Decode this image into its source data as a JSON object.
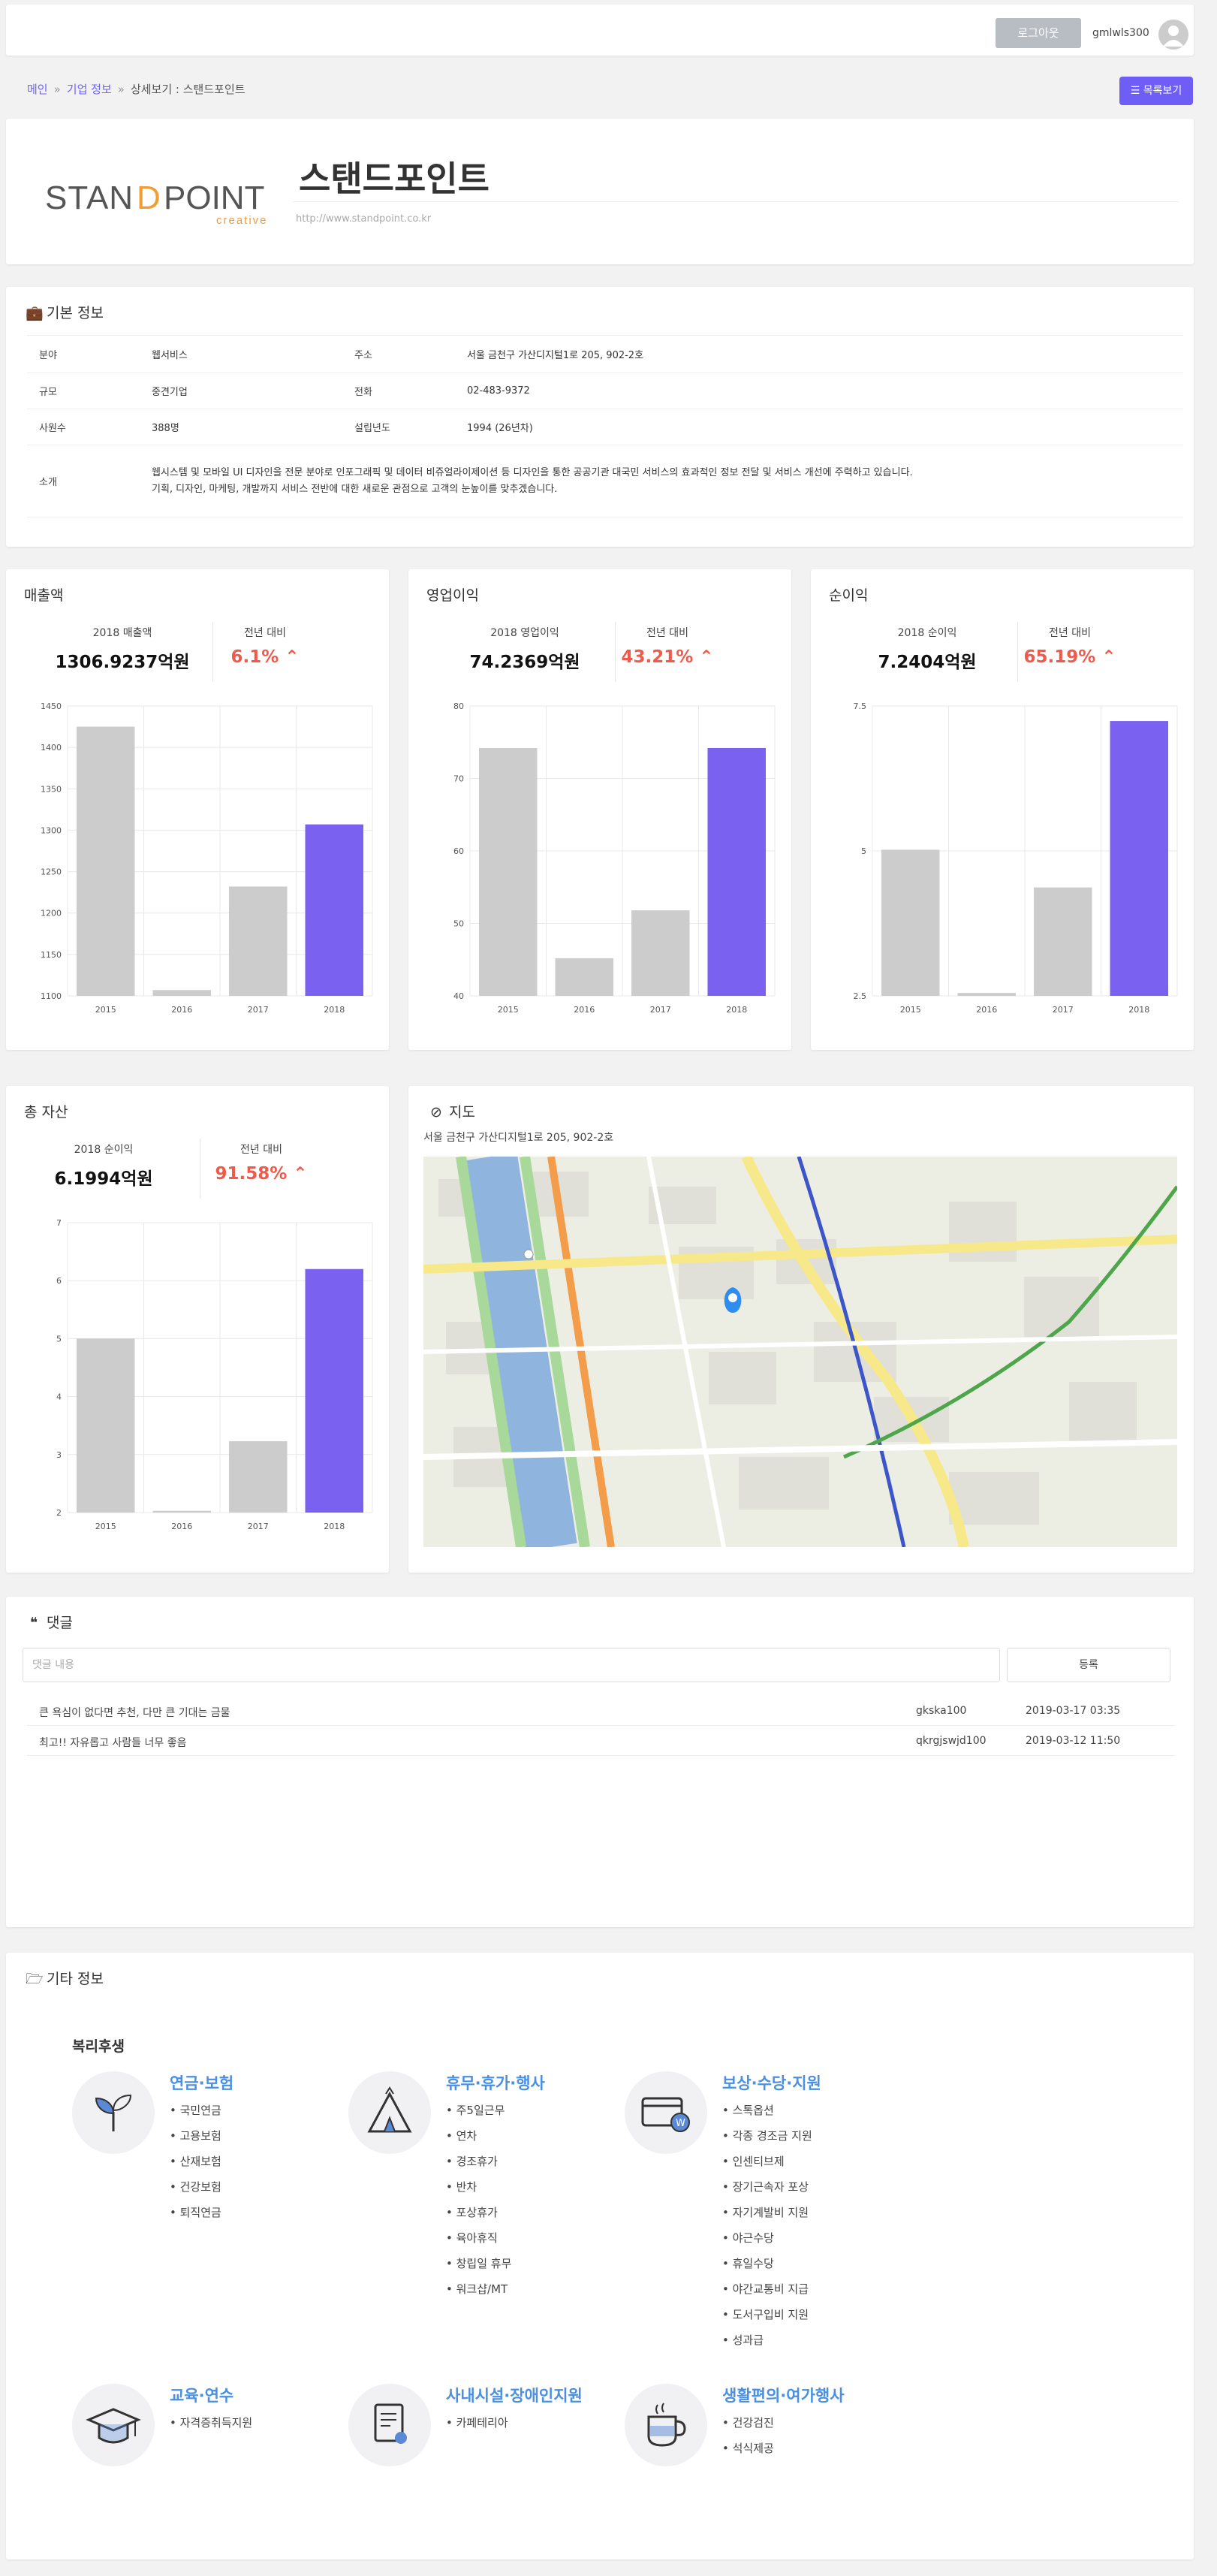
{
  "topbar": {
    "login_label": "로그아웃",
    "username": "gmlwls300"
  },
  "breadcrumb": {
    "home": "메인",
    "list": "기업 정보",
    "current": "상세보기 : 스탠드포인트",
    "sep": "»"
  },
  "list_button": "목록보기",
  "company": {
    "name": "스탠드포인트",
    "url": "http://www.standpoint.co.kr",
    "logo_text": "STANDPOINT",
    "logo_sub": "creative"
  },
  "basic": {
    "title": "기본 정보",
    "rows": {
      "field_label": "분야",
      "field": "웹서비스",
      "addr_label": "주소",
      "addr": "서울 금천구 가산디지털1로 205, 902-2호",
      "size_label": "규모",
      "size": "중견기업",
      "tel_label": "전화",
      "tel": "02-483-9372",
      "emp_label": "사원수",
      "emp": "388명",
      "est_label": "설립년도",
      "est": "1994 (26년차)",
      "intro_label": "소개",
      "intro1": "웹시스템 및 모바일 UI 디자인을 전문 분야로 인포그래픽 및 데이터 비쥬얼라이제이션 등 디자인을 통한 공공기관 대국민 서비스의 효과적인 정보 전달 및 서비스 개선에 주력하고 있습니다.",
      "intro2": "기획, 디자인, 마케팅, 개발까지 서비스 전반에 대한 새로운 관점으로 고객의 눈높이를 맞추겠습니다."
    }
  },
  "panels": [
    {
      "title": "매출액",
      "stat_label": "2018 매출액",
      "stat_value": "1306.9237",
      "unit": "억원",
      "rate_label": "전년 대비",
      "rate": "6.1%"
    },
    {
      "title": "영업이익",
      "stat_label": "2018 영업이익",
      "stat_value": "74.2369",
      "unit": "억원",
      "rate_label": "전년 대비",
      "rate": "43.21%"
    },
    {
      "title": "순이익",
      "stat_label": "2018 순이익",
      "stat_value": "7.2404",
      "unit": "억원",
      "rate_label": "전년 대비",
      "rate": "65.19%"
    },
    {
      "title": "총 자산",
      "stat_label": "2018 순이익",
      "stat_value": "6.1994",
      "unit": "억원",
      "rate_label": "전년 대비",
      "rate": "91.58%"
    }
  ],
  "chart_data": [
    {
      "type": "bar",
      "categories": [
        "2015",
        "2016",
        "2017",
        "2018"
      ],
      "values": [
        1425,
        1107,
        1232,
        1307
      ],
      "ylim": [
        1100,
        1450
      ],
      "yticks": [
        "1100",
        "1150",
        "1200",
        "1250",
        "1300",
        "1350",
        "1400",
        "1450"
      ],
      "grid": true,
      "colors": [
        "#cccccc",
        "#cccccc",
        "#cccccc",
        "#7b61f0"
      ]
    },
    {
      "type": "bar",
      "categories": [
        "2015",
        "2016",
        "2017",
        "2018"
      ],
      "values": [
        74.2,
        45.2,
        51.8,
        74.2
      ],
      "ylim": [
        40,
        80
      ],
      "yticks": [
        "40",
        "50",
        "60",
        "70",
        "80"
      ],
      "grid": true,
      "colors": [
        "#cccccc",
        "#cccccc",
        "#cccccc",
        "#7b61f0"
      ]
    },
    {
      "type": "bar",
      "categories": [
        "2015",
        "2016",
        "2017",
        "2018"
      ],
      "values": [
        5.02,
        2.55,
        4.37,
        7.24
      ],
      "ylim": [
        2.5,
        7.5
      ],
      "yticks": [
        "2.5",
        "5",
        "7.5"
      ],
      "grid": true,
      "colors": [
        "#cccccc",
        "#cccccc",
        "#cccccc",
        "#7b61f0"
      ]
    },
    {
      "type": "bar",
      "categories": [
        "2015",
        "2016",
        "2017",
        "2018"
      ],
      "values": [
        5.0,
        2.03,
        3.23,
        6.2
      ],
      "ylim": [
        2,
        7
      ],
      "yticks": [
        "2",
        "3",
        "4",
        "5",
        "6",
        "7"
      ],
      "grid": true,
      "colors": [
        "#cccccc",
        "#cccccc",
        "#cccccc",
        "#7b61f0"
      ]
    }
  ],
  "map": {
    "title": "지도",
    "address": "서울 금천구 가산디지털1로 205, 902-2호"
  },
  "comments": {
    "title": "댓글",
    "placeholder": "댓글 내용",
    "submit": "등록",
    "items": [
      {
        "text": "큰 욕심이 없다면 추천, 다만 큰 기대는 금물",
        "user": "gkska100",
        "date": "2019-03-17 03:35"
      },
      {
        "text": "최고!! 자유롭고 사람들 너무 좋음",
        "user": "qkrgjswjd100",
        "date": "2019-03-12 11:50"
      }
    ]
  },
  "etc": {
    "title": "기타 정보",
    "welfare_title": "복리후생",
    "groups": [
      {
        "name": "연금·보험",
        "icon": "plant-icon",
        "items": [
          "국민연금",
          "고용보험",
          "산재보험",
          "건강보험",
          "퇴직연금"
        ]
      },
      {
        "name": "휴무·휴가·행사",
        "icon": "tent-icon",
        "items": [
          "주5일근무",
          "연차",
          "경조휴가",
          "반차",
          "포상휴가",
          "육아휴직",
          "창립일 휴무",
          "워크샵/MT"
        ]
      },
      {
        "name": "보상·수당·지원",
        "icon": "card-icon",
        "items": [
          "스톡옵션",
          "각종 경조금 지원",
          "인센티브제",
          "장기근속자 포상",
          "자기계발비 지원",
          "야근수당",
          "휴일수당",
          "야간교통비 지급",
          "도서구입비 지원",
          "성과급"
        ]
      },
      {
        "name": "교육·연수",
        "icon": "graduation-cap-icon",
        "items": [
          "자격증취득지원"
        ]
      },
      {
        "name": "사내시설·장애인지원",
        "icon": "document-icon",
        "items": [
          "카페테리아"
        ]
      },
      {
        "name": "생활편의·여가행사",
        "icon": "coffee-cup-icon",
        "items": [
          "건강검진",
          "석식제공"
        ]
      }
    ]
  }
}
